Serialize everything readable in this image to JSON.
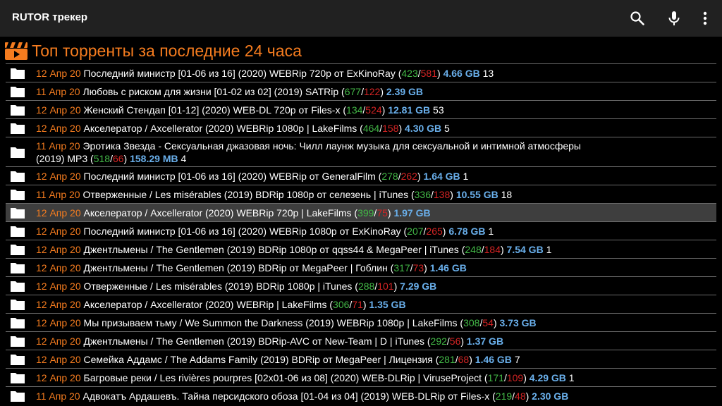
{
  "app": {
    "title": "RUTOR трекер",
    "icons": [
      "search-icon",
      "microphone-icon",
      "more-vert-icon"
    ]
  },
  "colors": {
    "accent": "#f57c1f",
    "seeders": "#43b947",
    "leechers": "#d42424",
    "size": "#6ab0ec",
    "appbar": "#212121",
    "selected_row": "#3e3e3e"
  },
  "section": {
    "title": "Топ торренты за последние 24 часа",
    "icon": "clapperboard-icon"
  },
  "torrents": [
    {
      "date": "12 Апр 20",
      "title": "Последний министр [01-06 из 16] (2020) WEBRip 720p от ExKinoRay",
      "seeders": "423",
      "leechers": "581",
      "size": "4.66 GB",
      "comments": "13"
    },
    {
      "date": "11 Апр 20",
      "title": "Любовь с риском для жизни [01-02 из 02] (2019) SATRip",
      "seeders": "677",
      "leechers": "122",
      "size": "2.39 GB",
      "comments": ""
    },
    {
      "date": "12 Апр 20",
      "title": "Женский Стендап [01-12] (2020) WEB-DL 720p от Files-x",
      "seeders": "134",
      "leechers": "524",
      "size": "12.81 GB",
      "comments": "53"
    },
    {
      "date": "12 Апр 20",
      "title": "Акселератор / Axcellerator (2020) WEBRip 1080p | LakeFilms",
      "seeders": "464",
      "leechers": "158",
      "size": "4.30 GB",
      "comments": "5"
    },
    {
      "date": "11 Апр 20",
      "title": "Эротика Звезда - Сексуальная джазовая ночь: Чилл лаунж музыка для сексуальной и интимной атмосферы (2019) MP3",
      "seeders": "518",
      "leechers": "66",
      "size": "158.29 MB",
      "comments": "4"
    },
    {
      "date": "12 Апр 20",
      "title": "Последний министр [01-06 из 16] (2020) WEBRip от GeneralFilm",
      "seeders": "278",
      "leechers": "262",
      "size": "1.64 GB",
      "comments": "1"
    },
    {
      "date": "11 Апр 20",
      "title": "Отверженные / Les misérables (2019) BDRip 1080p от селезень | iTunes",
      "seeders": "336",
      "leechers": "138",
      "size": "10.55 GB",
      "comments": "18"
    },
    {
      "date": "12 Апр 20",
      "title": "Акселератор / Axcellerator (2020) WEBRip 720p | LakeFilms",
      "seeders": "399",
      "leechers": "75",
      "size": "1.97 GB",
      "comments": ""
    },
    {
      "date": "12 Апр 20",
      "title": "Последний министр [01-06 из 16] (2020) WEBRip 1080p от ExKinoRay",
      "seeders": "207",
      "leechers": "265",
      "size": "6.78 GB",
      "comments": "1"
    },
    {
      "date": "12 Апр 20",
      "title": "Джентльмены / The Gentlemen (2019) BDRip 1080p от qqss44 & MegaPeer | iTunes",
      "seeders": "248",
      "leechers": "184",
      "size": "7.54 GB",
      "comments": "1"
    },
    {
      "date": "12 Апр 20",
      "title": "Джентльмены / The Gentlemen (2019) BDRip от MegaPeer | Гоблин",
      "seeders": "317",
      "leechers": "73",
      "size": "1.46 GB",
      "comments": ""
    },
    {
      "date": "12 Апр 20",
      "title": "Отверженные / Les misérables (2019) BDRip 1080p | iTunes",
      "seeders": "288",
      "leechers": "101",
      "size": "7.29 GB",
      "comments": ""
    },
    {
      "date": "12 Апр 20",
      "title": "Акселератор / Axcellerator (2020) WEBRip | LakeFilms",
      "seeders": "306",
      "leechers": "71",
      "size": "1.35 GB",
      "comments": ""
    },
    {
      "date": "12 Апр 20",
      "title": "Мы призываем тьму / We Summon the Darkness (2019) WEBRip 1080p | LakeFilms",
      "seeders": "308",
      "leechers": "54",
      "size": "3.73 GB",
      "comments": ""
    },
    {
      "date": "12 Апр 20",
      "title": "Джентльмены / The Gentlemen (2019) BDRip-AVC от New-Team | D | iTunes",
      "seeders": "292",
      "leechers": "56",
      "size": "1.37 GB",
      "comments": ""
    },
    {
      "date": "12 Апр 20",
      "title": "Семейка Аддамс / The Addams Family (2019) BDRip от MegaPeer | Лицензия",
      "seeders": "281",
      "leechers": "68",
      "size": "1.46 GB",
      "comments": "7"
    },
    {
      "date": "12 Апр 20",
      "title": "Багровые реки / Les rivières pourpres [02x01-06 из 08] (2020) WEB-DLRip | ViruseProject",
      "seeders": "171",
      "leechers": "109",
      "size": "4.29 GB",
      "comments": "1"
    },
    {
      "date": "11 Апр 20",
      "title": "Адвокатъ Ардашевъ. Тайна персидского обоза [01-04 из 04] (2019) WEB-DLRip от Files-x",
      "seeders": "219",
      "leechers": "48",
      "size": "2.30 GB",
      "comments": ""
    }
  ]
}
